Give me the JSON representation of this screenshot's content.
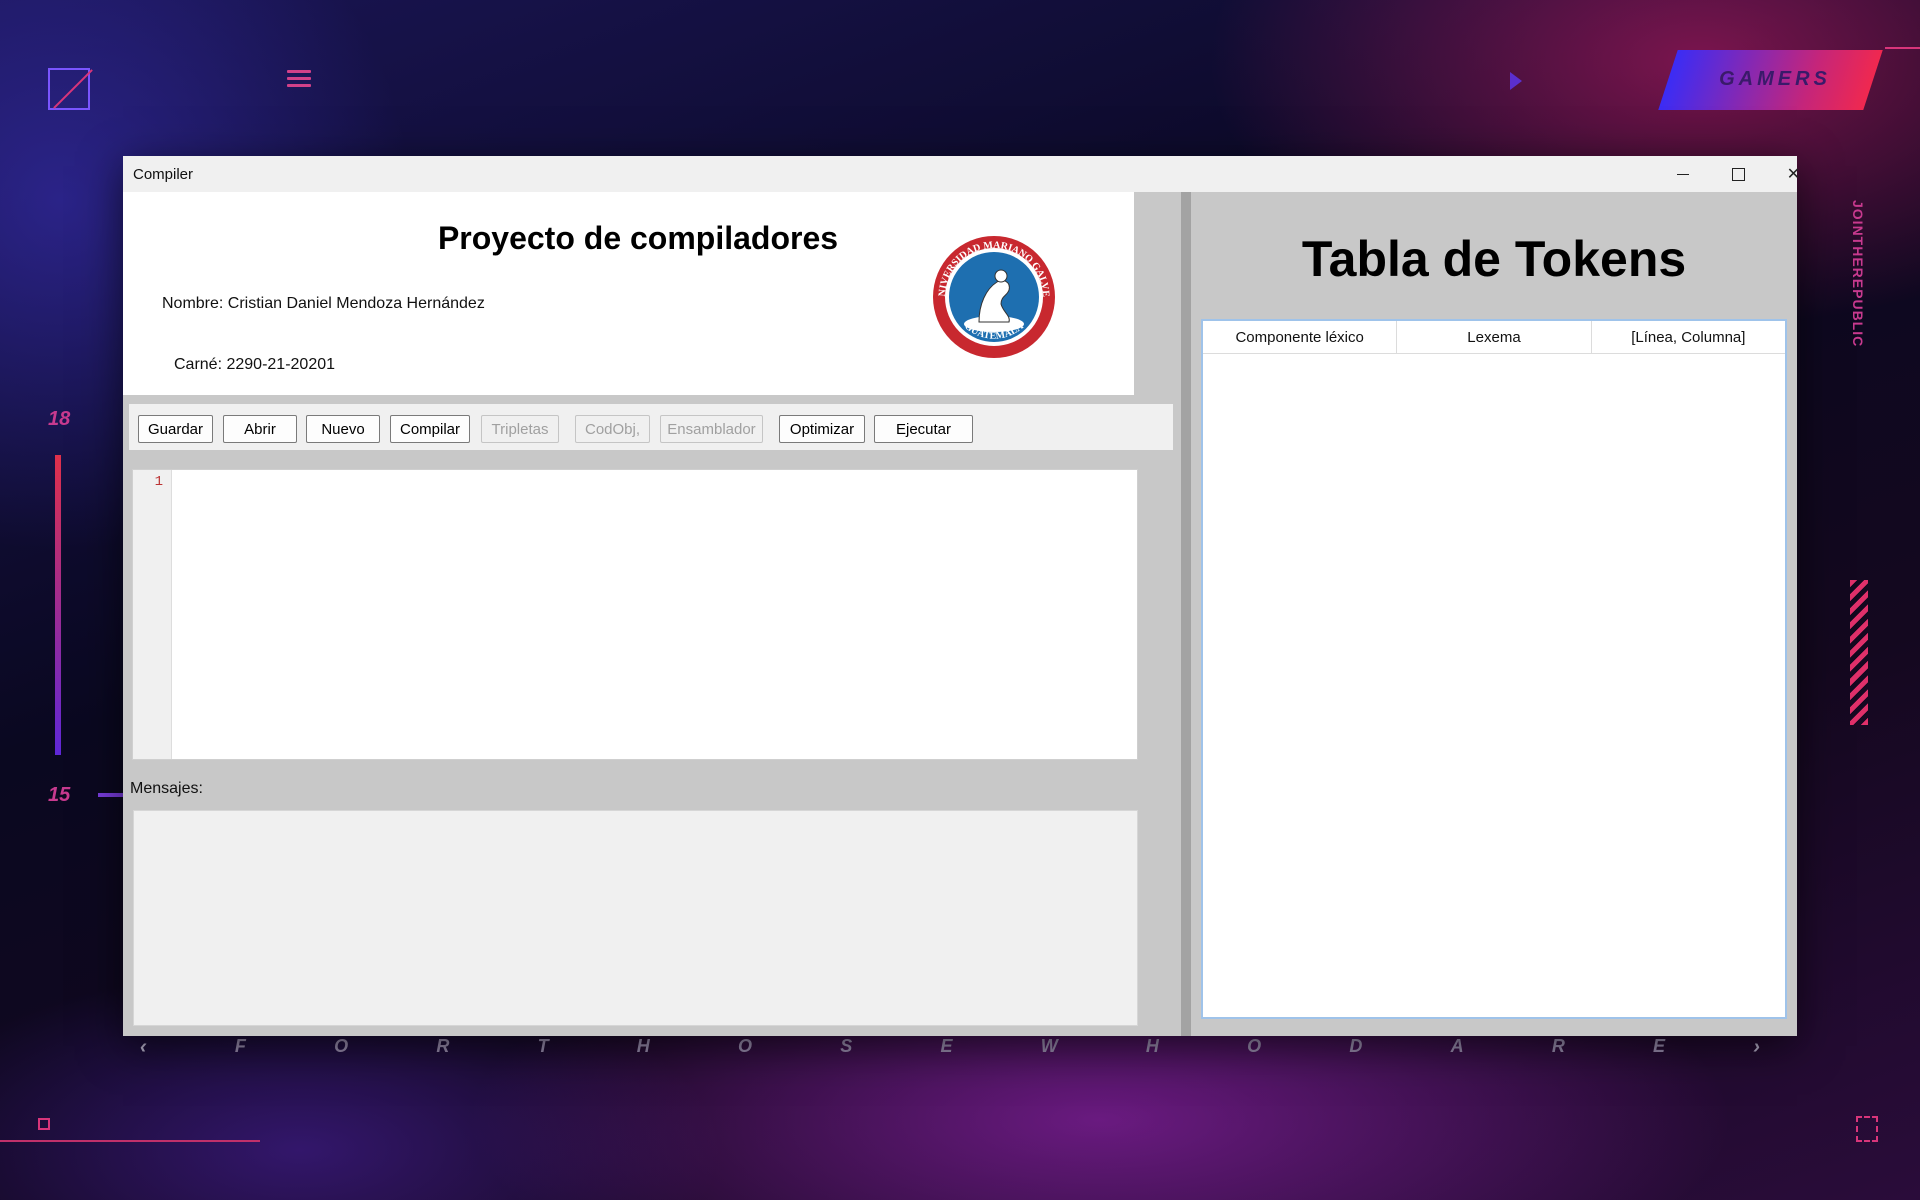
{
  "wallpaper": {
    "badge": "GAMERS",
    "num_top": "18",
    "num_bottom": "15",
    "vertical_text": "JOINTHEREPUBLIC",
    "bottom_letters": [
      "F",
      "O",
      "R",
      "T",
      "H",
      "O",
      "S",
      "E",
      "W",
      "H",
      "O",
      "D",
      "A",
      "R",
      "E"
    ],
    "arrow_left": "‹",
    "arrow_right": "›"
  },
  "window": {
    "title": "Compiler",
    "minimize": "",
    "maximize": "",
    "close": "✕"
  },
  "header": {
    "title": "Proyecto de compiladores",
    "name": "Nombre: Cristian Daniel Mendoza Hernández",
    "carne": "Carné: 2290-21-20201",
    "seal": {
      "top_text": "UNIVERSIDAD MARIANO GALVEZ",
      "bottom_text": "GUATEMALA"
    }
  },
  "toolbar": {
    "buttons": [
      {
        "label": "Guardar",
        "enabled": true
      },
      {
        "label": "Abrir",
        "enabled": true
      },
      {
        "label": "Nuevo",
        "enabled": true
      },
      {
        "label": "Compilar",
        "enabled": true
      },
      {
        "label": "Tripletas",
        "enabled": false
      },
      {
        "label": "CodObj,",
        "enabled": false
      },
      {
        "label": "Ensamblador",
        "enabled": false
      },
      {
        "label": "Optimizar",
        "enabled": true
      },
      {
        "label": "Ejecutar",
        "enabled": true
      }
    ]
  },
  "editor": {
    "line_numbers": [
      "1"
    ],
    "content": ""
  },
  "messages": {
    "label": "Mensajes:",
    "content": ""
  },
  "tokens": {
    "title": "Tabla de Tokens",
    "columns": [
      "Componente léxico",
      "Lexema",
      "[Línea, Columna]"
    ],
    "rows": []
  },
  "colors": {
    "accent_pink": "#d8357a",
    "accent_purple": "#5e27d8",
    "table_border": "#9fc3ea",
    "seal_red": "#c8282f",
    "seal_blue": "#1e6fb0"
  }
}
